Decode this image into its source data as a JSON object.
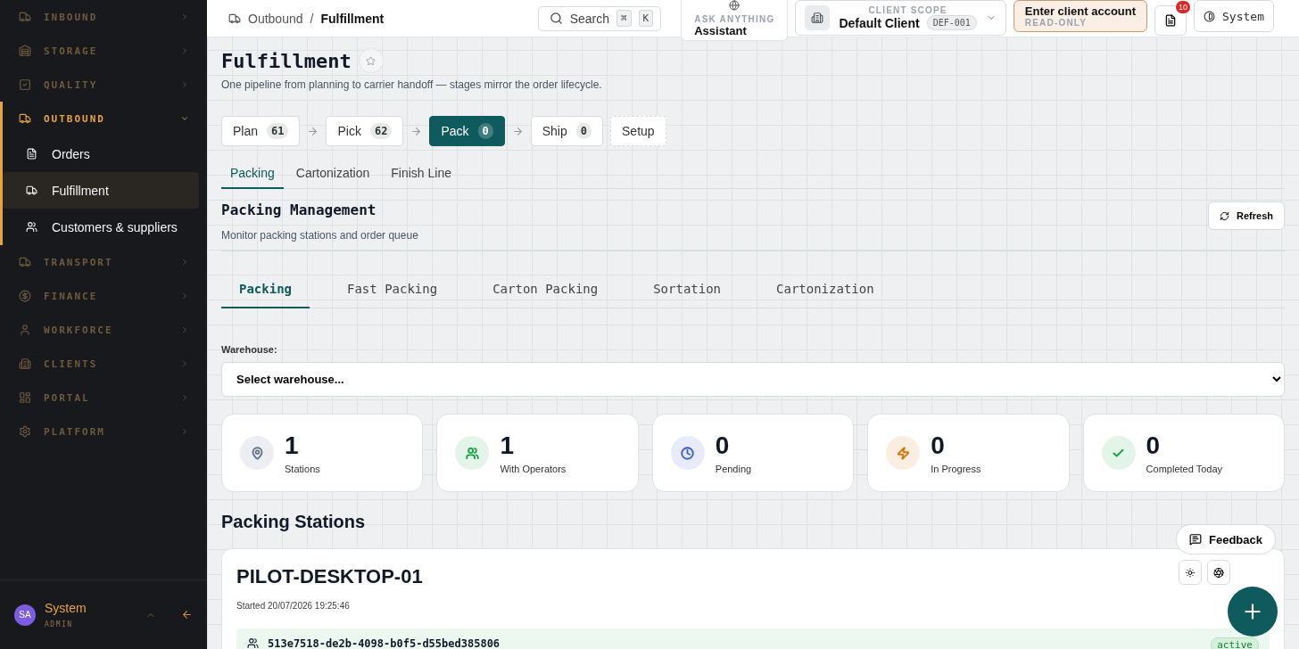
{
  "sidebar": {
    "groups": [
      {
        "label": "INBOUND",
        "expanded": false
      },
      {
        "label": "STORAGE",
        "expanded": false
      },
      {
        "label": "QUALITY",
        "expanded": false
      },
      {
        "label": "OUTBOUND",
        "expanded": true,
        "children": [
          {
            "label": "Orders",
            "selected": false
          },
          {
            "label": "Fulfillment",
            "selected": true
          },
          {
            "label": "Customers & suppliers",
            "selected": false
          }
        ]
      },
      {
        "label": "TRANSPORT",
        "expanded": false
      },
      {
        "label": "FINANCE",
        "expanded": false
      },
      {
        "label": "WORKFORCE",
        "expanded": false
      },
      {
        "label": "CLIENTS",
        "expanded": false
      },
      {
        "label": "PORTAL",
        "expanded": false
      },
      {
        "label": "PLATFORM",
        "expanded": false
      }
    ],
    "user": {
      "initials": "SA",
      "name": "System",
      "role": "ADMIN"
    }
  },
  "topbar": {
    "breadcrumb": [
      "Outbound",
      "Fulfillment"
    ],
    "breadcrumb_separator": "/",
    "search": {
      "label": "Search",
      "keys": [
        "⌘",
        "K"
      ]
    },
    "assistant": {
      "caption": "ASK ANYTHING",
      "label": "Assistant"
    },
    "client_scope": {
      "caption": "CLIENT SCOPE",
      "name": "Default Client",
      "code": "DEF-001"
    },
    "client_account": {
      "label": "Enter client account",
      "caption": "READ-ONLY"
    },
    "notifications": {
      "count": "10"
    },
    "theme": {
      "label": "System"
    }
  },
  "page": {
    "title": "Fulfillment",
    "subtitle": "One pipeline from planning to carrier handoff — stages mirror the order lifecycle.",
    "stages": [
      {
        "kind": "stage",
        "label": "Plan",
        "count": "61",
        "selected": false
      },
      {
        "kind": "stage",
        "label": "Pick",
        "count": "62",
        "selected": false
      },
      {
        "kind": "stage",
        "label": "Pack",
        "count": "0",
        "selected": true
      },
      {
        "kind": "stage",
        "label": "Ship",
        "count": "0",
        "selected": false
      },
      {
        "kind": "setup",
        "label": "Setup",
        "selected": false
      }
    ],
    "sub_tabs": [
      {
        "label": "Packing",
        "selected": true
      },
      {
        "label": "Cartonization",
        "selected": false
      },
      {
        "label": "Finish Line",
        "selected": false
      }
    ],
    "section": {
      "title": "Packing Management",
      "subtitle": "Monitor packing stations and order queue",
      "refresh": "Refresh"
    },
    "inner_tabs": [
      {
        "label": "Packing",
        "selected": true
      },
      {
        "label": "Fast Packing",
        "selected": false
      },
      {
        "label": "Carton Packing",
        "selected": false
      },
      {
        "label": "Sortation",
        "selected": false
      },
      {
        "label": "Cartonization",
        "selected": false
      }
    ],
    "warehouse": {
      "label": "Warehouse:",
      "placeholder": "Select warehouse..."
    },
    "stats": [
      {
        "value": "1",
        "label": "Stations",
        "color": "#64748b"
      },
      {
        "value": "1",
        "label": "With Operators",
        "color": "#16a34a"
      },
      {
        "value": "0",
        "label": "Pending",
        "color": "#3b5bdb"
      },
      {
        "value": "0",
        "label": "In Progress",
        "color": "#d97706"
      },
      {
        "value": "0",
        "label": "Completed Today",
        "color": "#16a34a"
      }
    ],
    "stations_title": "Packing Stations",
    "station": {
      "name": "PILOT-DESKTOP-01",
      "started": "Started 20/07/2026 19:25:46",
      "operator": "513e7518-de2b-4098-b0f5-d55bed385806",
      "status": "active"
    },
    "feedback": "Feedback"
  }
}
